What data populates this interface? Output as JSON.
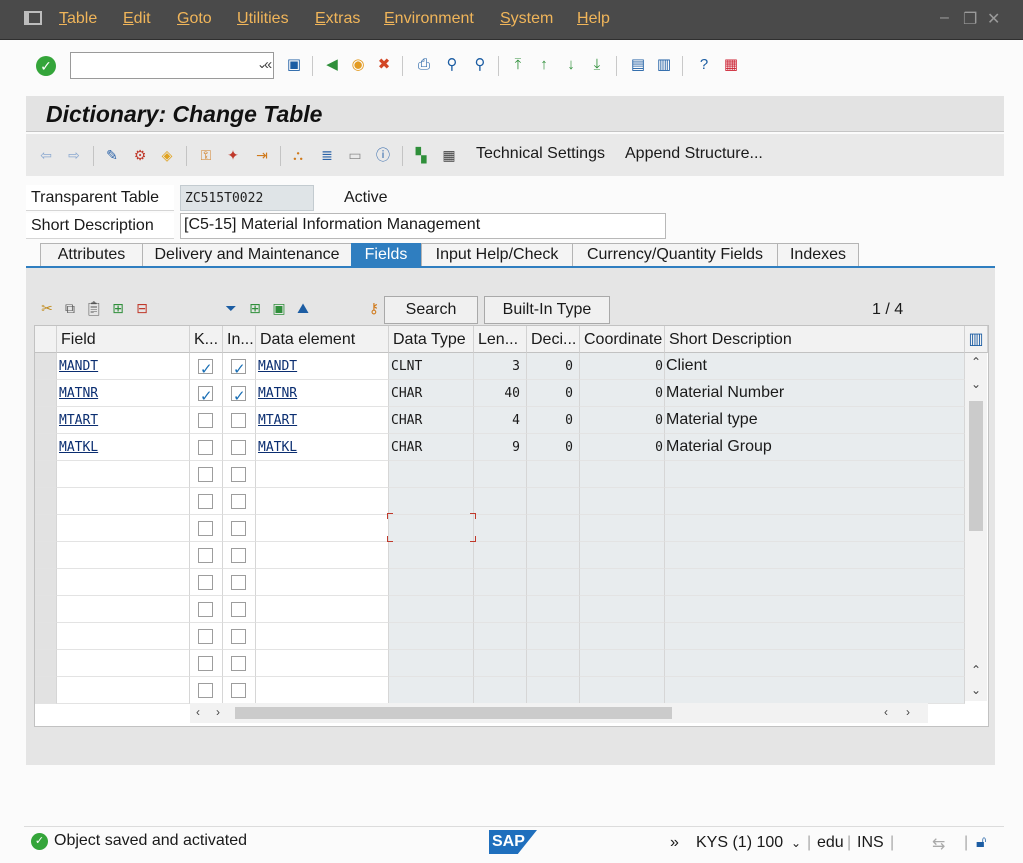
{
  "menu": [
    "Table",
    "Edit",
    "Goto",
    "Utilities",
    "Extras",
    "Environment",
    "System",
    "Help"
  ],
  "window_controls": [
    "–",
    "❐",
    "✕"
  ],
  "toolbar": {
    "command_value": "",
    "icons": [
      "enter-check-icon",
      "save-icon",
      "back-icon",
      "exit-icon",
      "cancel-icon",
      "print-icon",
      "find-icon",
      "find-next-icon",
      "first-page-icon",
      "previous-page-icon",
      "next-page-icon",
      "last-page-icon",
      "new-session-icon",
      "shortcut-icon",
      "help-icon",
      "customize-layout-icon"
    ]
  },
  "title": "Dictionary: Change Table",
  "app_toolbar": {
    "technical_settings": "Technical Settings",
    "append_structure": "Append Structure..."
  },
  "header": {
    "table_type_label": "Transparent Table",
    "table_name": "ZC515T0022",
    "status": "Active",
    "short_desc_label": "Short Description",
    "short_desc_value": "[C5-15] Material Information Management"
  },
  "tabs": [
    "Attributes",
    "Delivery and Maintenance",
    "Fields",
    "Input Help/Check",
    "Currency/Quantity Fields",
    "Indexes"
  ],
  "active_tab": "Fields",
  "fields_toolbar": {
    "search": "Search",
    "builtin_type": "Built-In Type",
    "page": "1 / 4"
  },
  "columns": [
    "Field",
    "K...",
    "In...",
    "Data element",
    "Data Type",
    "Len...",
    "Deci...",
    "Coordinate",
    "Short Description"
  ],
  "rows": [
    {
      "field": "MANDT",
      "key": true,
      "initial": true,
      "data_element": "MANDT",
      "data_type": "CLNT",
      "length": "3",
      "decimals": "0",
      "coordinate": "0",
      "short_description": "Client"
    },
    {
      "field": "MATNR",
      "key": true,
      "initial": true,
      "data_element": "MATNR",
      "data_type": "CHAR",
      "length": "40",
      "decimals": "0",
      "coordinate": "0",
      "short_description": "Material Number"
    },
    {
      "field": "MTART",
      "key": false,
      "initial": false,
      "data_element": "MTART",
      "data_type": "CHAR",
      "length": "4",
      "decimals": "0",
      "coordinate": "0",
      "short_description": "Material type"
    },
    {
      "field": "MATKL",
      "key": false,
      "initial": false,
      "data_element": "MATKL",
      "data_type": "CHAR",
      "length": "9",
      "decimals": "0",
      "coordinate": "0",
      "short_description": "Material Group"
    }
  ],
  "empty_rows": 9,
  "status_bar": {
    "message": "Object saved and activated",
    "logo": "SAP",
    "more": "»",
    "system": "KYS (1) 100",
    "user": "edu",
    "mode": "INS"
  },
  "colors": {
    "accent": "#2f7ec0",
    "menu_bg": "#4a4a4a",
    "menu_text": "#f0b55a",
    "success": "#34a53a"
  }
}
